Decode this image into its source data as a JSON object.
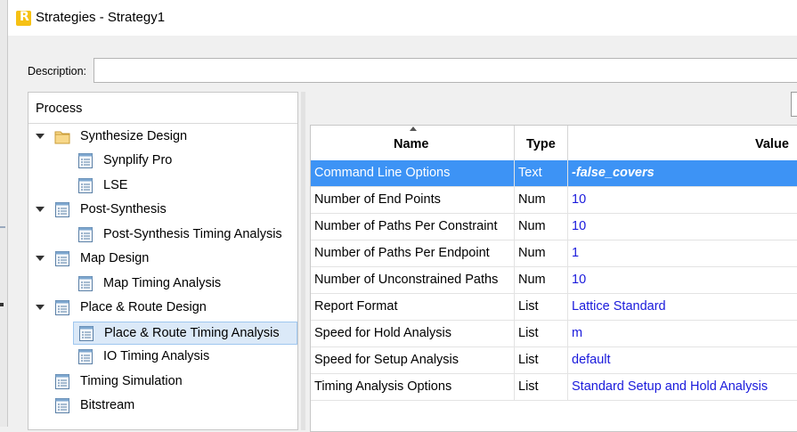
{
  "window": {
    "title": "Strategies - Strategy1",
    "app_icon_letter": "R"
  },
  "description": {
    "label": "Description:",
    "value": ""
  },
  "process": {
    "header": "Process",
    "items": [
      {
        "label": "Synthesize Design",
        "icon": "folder-icon",
        "expandable": true
      },
      {
        "label": "Synplify Pro",
        "icon": "list-doc-icon"
      },
      {
        "label": "LSE",
        "icon": "list-doc-icon"
      },
      {
        "label": "Post-Synthesis",
        "icon": "list-doc-icon",
        "expandable": true
      },
      {
        "label": "Post-Synthesis Timing Analysis",
        "icon": "list-doc-icon"
      },
      {
        "label": "Map Design",
        "icon": "list-doc-icon",
        "expandable": true
      },
      {
        "label": "Map Timing Analysis",
        "icon": "list-doc-icon"
      },
      {
        "label": "Place & Route Design",
        "icon": "list-doc-icon",
        "expandable": true
      },
      {
        "label": "Place & Route Timing Analysis",
        "icon": "list-doc-icon",
        "selected": true
      },
      {
        "label": "IO Timing Analysis",
        "icon": "list-doc-icon"
      },
      {
        "label": "Timing Simulation",
        "icon": "list-doc-icon"
      },
      {
        "label": "Bitstream",
        "icon": "list-doc-icon"
      }
    ]
  },
  "table": {
    "columns": [
      "Name",
      "Type",
      "Value"
    ],
    "rows": [
      {
        "name": "Command Line Options",
        "type": "Text",
        "value": "-false_covers",
        "selected": true
      },
      {
        "name": "Number of End Points",
        "type": "Num",
        "value": "10"
      },
      {
        "name": "Number of Paths Per Constraint",
        "type": "Num",
        "value": "10"
      },
      {
        "name": "Number of Paths Per Endpoint",
        "type": "Num",
        "value": "1"
      },
      {
        "name": "Number of Unconstrained Paths",
        "type": "Num",
        "value": "10"
      },
      {
        "name": "Report Format",
        "type": "List",
        "value": "Lattice Standard"
      },
      {
        "name": "Speed for Hold Analysis",
        "type": "List",
        "value": "m"
      },
      {
        "name": "Speed for Setup Analysis",
        "type": "List",
        "value": "default"
      },
      {
        "name": "Timing Analysis Options",
        "type": "List",
        "value": "Standard Setup and Hold Analysis"
      }
    ]
  },
  "colors": {
    "selection": "#3d93f5",
    "value_text": "#1a1adc",
    "tree_selection": "#dbe9f8"
  }
}
